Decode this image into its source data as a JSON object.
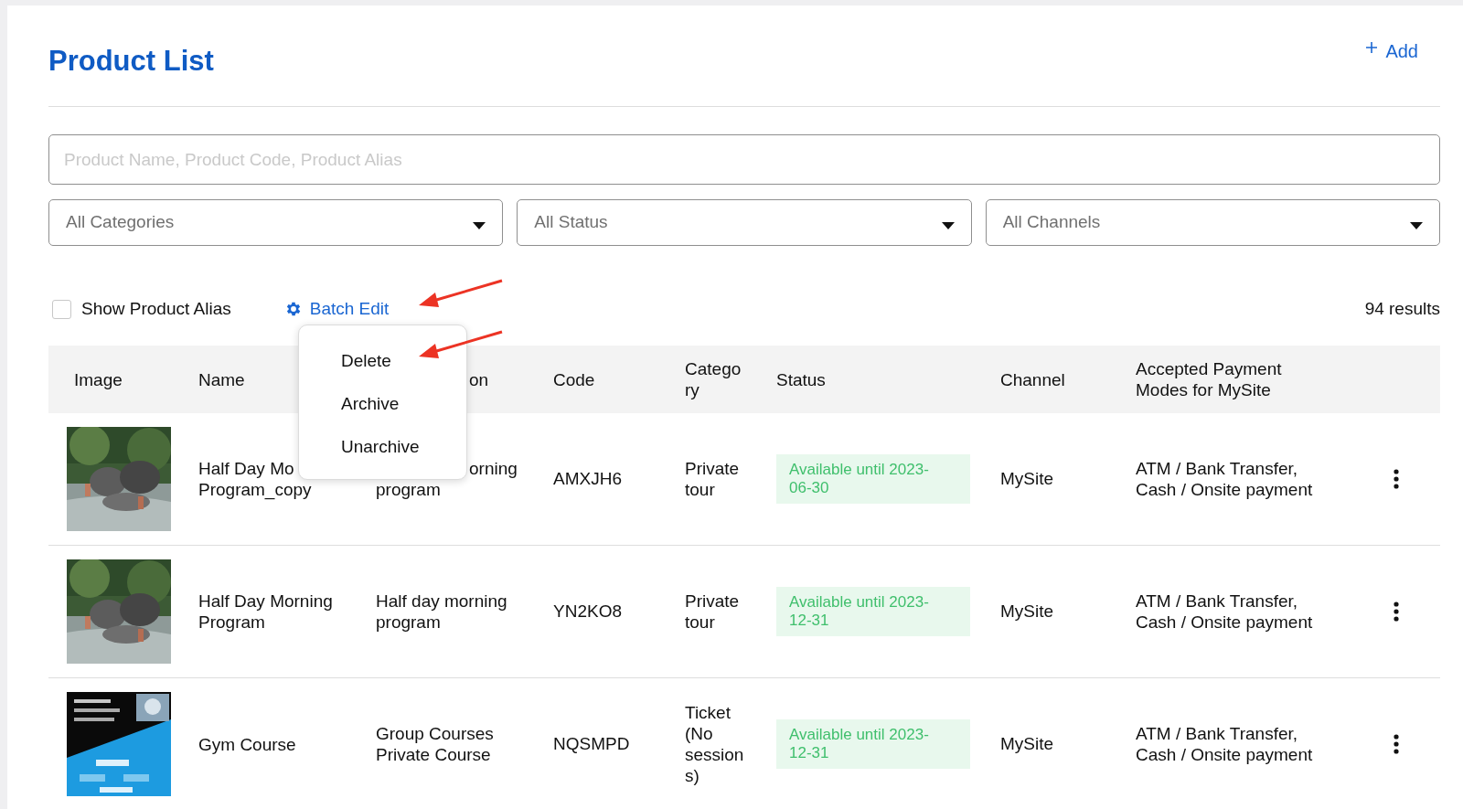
{
  "page_title": "Product List",
  "add_button": {
    "label": "Add"
  },
  "search": {
    "placeholder": "Product Name, Product Code, Product Alias"
  },
  "filters": [
    {
      "label": "All Categories"
    },
    {
      "label": "All Status"
    },
    {
      "label": "All Channels"
    }
  ],
  "show_alias": {
    "label": "Show Product Alias",
    "checked": false
  },
  "batch_edit": {
    "label": "Batch Edit",
    "expanded": true,
    "menu": [
      {
        "label": "Delete"
      },
      {
        "label": "Archive"
      },
      {
        "label": "Unarchive"
      }
    ]
  },
  "results": "94 results",
  "table": {
    "columns": [
      {
        "label": "Image"
      },
      {
        "label": "Name"
      },
      {
        "label": "on",
        "hidden_start": true
      },
      {
        "label": "Code"
      },
      {
        "label": "Category"
      },
      {
        "label": "Status"
      },
      {
        "label": "Channel"
      },
      {
        "label": "Accepted Payment Modes for MySite"
      }
    ],
    "rows": [
      {
        "image": {
          "kind": "picture"
        },
        "name": [
          "Half Day Mo",
          "Program_copy"
        ],
        "description": [
          "orning",
          "program"
        ],
        "description_hidden_start": true,
        "code": "AMXJH6",
        "category": "Private tour",
        "status": "Available until 2023-06-30",
        "channel": "MySite",
        "payment": "ATM / Bank Transfer, Cash / Onsite payment"
      },
      {
        "image": {
          "kind": "picture"
        },
        "name": [
          "Half Day Morning",
          "Program"
        ],
        "description": [
          "Half day morning",
          "program"
        ],
        "description_hidden_start": false,
        "code": "YN2KO8",
        "category": "Private tour",
        "status": "Available until 2023-12-31",
        "channel": "MySite",
        "payment": "ATM / Bank Transfer, Cash / Onsite payment"
      },
      {
        "image": {
          "kind": "picture"
        },
        "name": [
          "Gym Course"
        ],
        "description": [
          "Group Courses",
          "Private Course"
        ],
        "description_hidden_start": false,
        "code": "NQSMPD",
        "category": "Ticket (No sessions)",
        "status": "Available until 2023-12-31",
        "channel": "MySite",
        "payment": "ATM / Bank Transfer, Cash / Onsite payment"
      }
    ]
  }
}
